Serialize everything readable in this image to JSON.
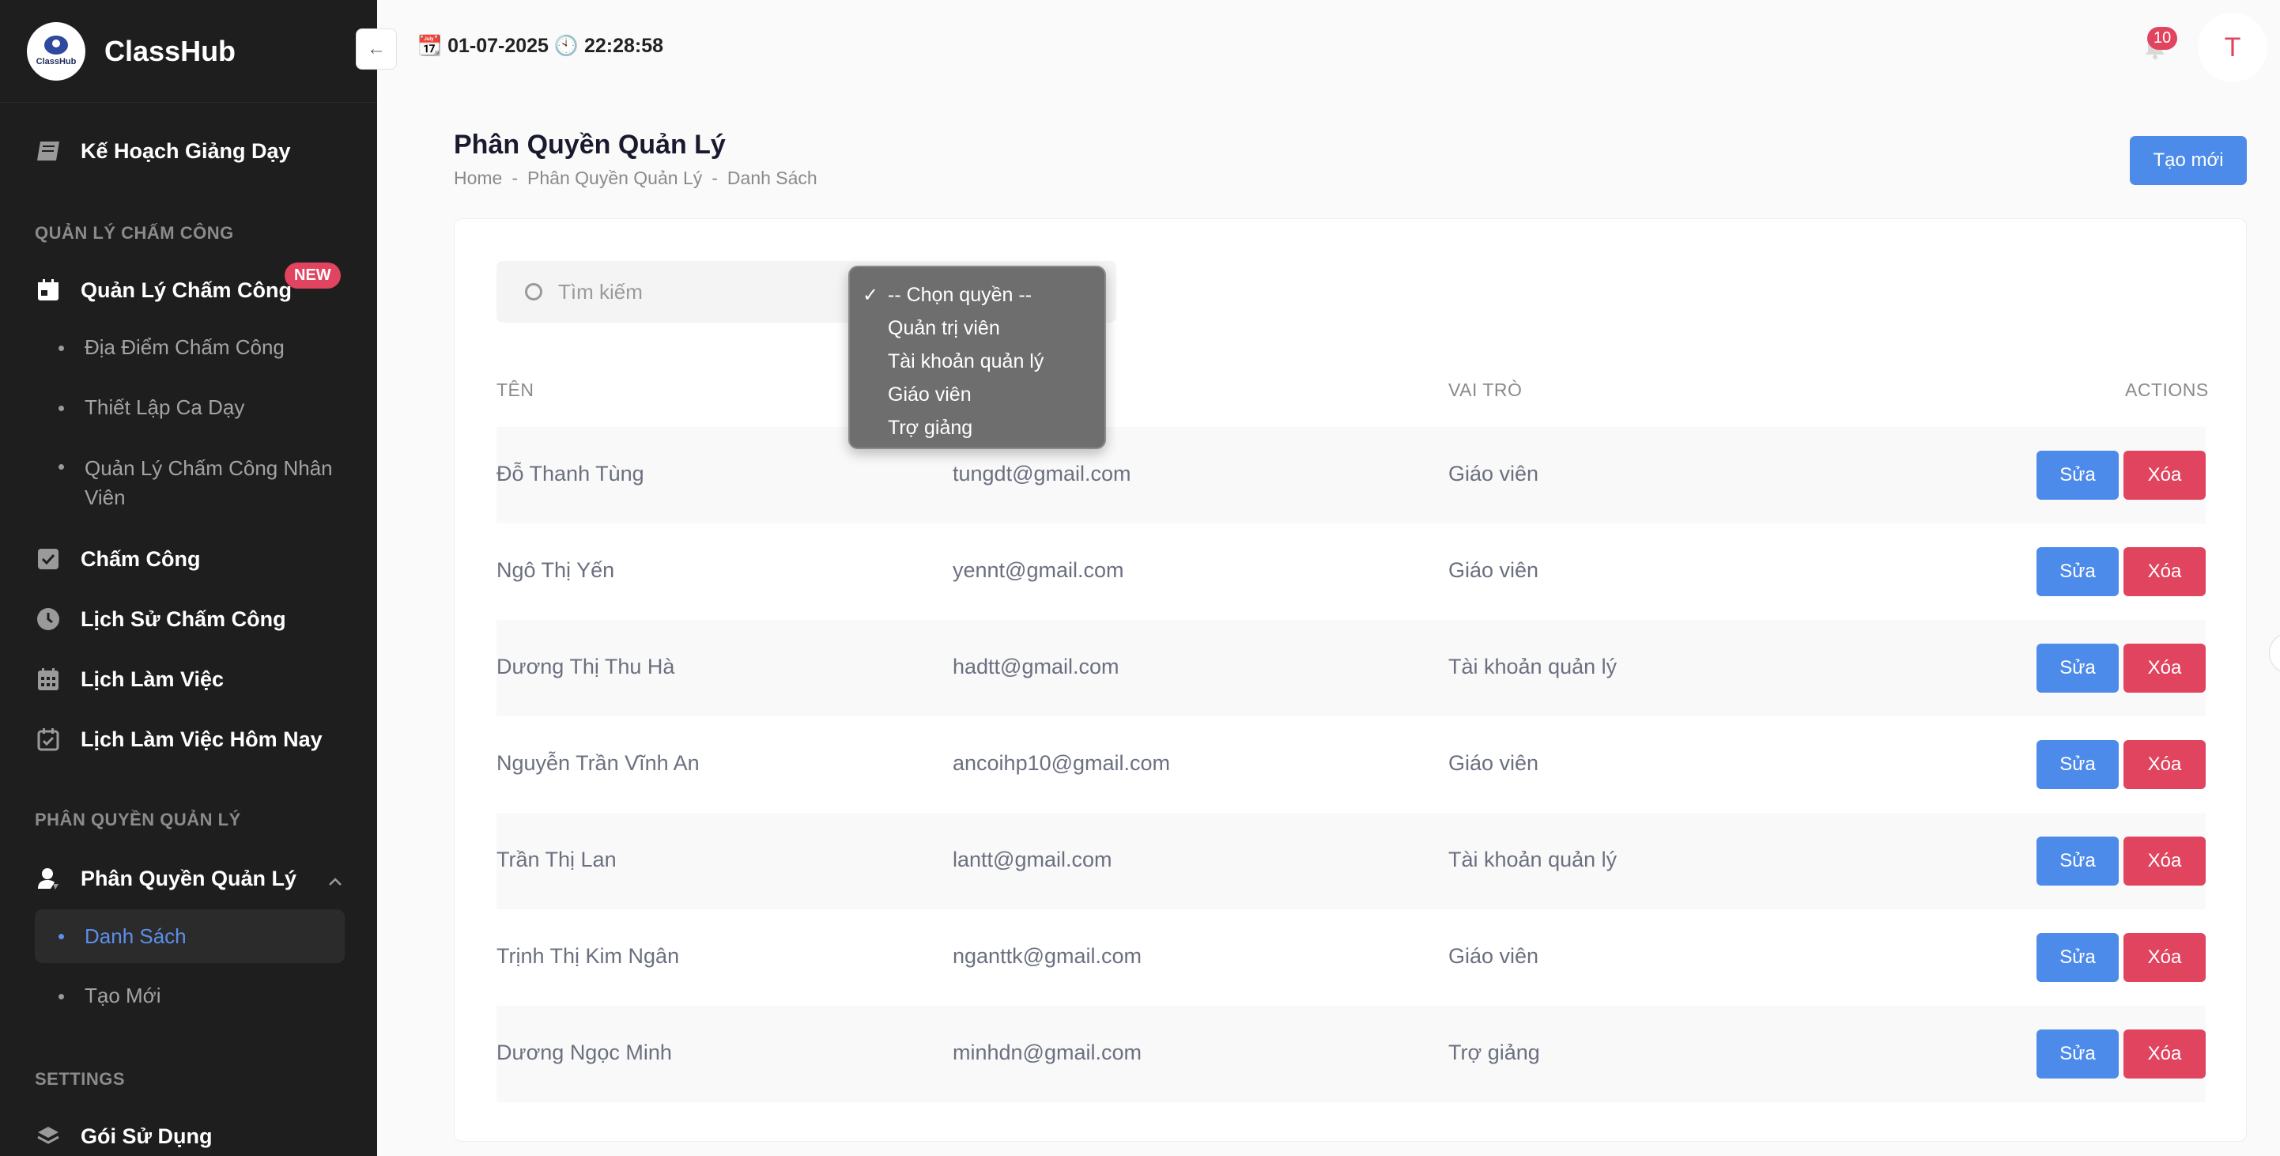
{
  "brand": {
    "name": "ClassHub",
    "logo_text": "ClassHub"
  },
  "header": {
    "datetime": "📆 01-07-2025 🕙 22:28:58",
    "notification_count": "10",
    "avatar_initial": "T",
    "collapse_icon": "←"
  },
  "sidebar": {
    "top_item": "Kế Hoạch Giảng Dạy",
    "section_attendance": "QUẢN LÝ CHẤM CÔNG",
    "attendance_manage": "Quản Lý Chấm Công",
    "new_badge": "NEW",
    "sub_locations": "Địa Điểm Chấm Công",
    "sub_shifts": "Thiết Lập Ca Dạy",
    "sub_staff_line1": "Quản Lý Chấm Công Nhân",
    "sub_staff_line2": "Viên",
    "checkin": "Chấm Công",
    "history": "Lịch Sử Chấm Công",
    "schedule": "Lịch Làm Việc",
    "schedule_today": "Lịch Làm Việc Hôm Nay",
    "section_perm": "PHÂN QUYỀN QUẢN LÝ",
    "perm_manage": "Phân Quyền Quản Lý",
    "perm_list": "Danh Sách",
    "perm_create": "Tạo Mới",
    "section_settings": "SETTINGS",
    "plans": "Gói Sử Dụng"
  },
  "page": {
    "title": "Phân Quyền Quản Lý",
    "breadcrumb": [
      "Home",
      "-",
      "Phân Quyền Quản Lý",
      "-",
      "Danh Sách"
    ],
    "create_button": "Tạo mới"
  },
  "search": {
    "placeholder": "Tìm kiếm"
  },
  "role_dropdown": {
    "check": "✓",
    "options": [
      "-- Chọn quyền --",
      "Quản trị viên",
      "Tài khoản quản lý",
      "Giáo viên",
      "Trợ giảng"
    ]
  },
  "table": {
    "headers": {
      "name": "TÊN",
      "role": "VAI TRÒ",
      "actions": "ACTIONS"
    },
    "edit_label": "Sửa",
    "delete_label": "Xóa",
    "rows": [
      {
        "name": "Đỗ Thanh Tùng",
        "email": "tungdt@gmail.com",
        "role": "Giáo viên"
      },
      {
        "name": "Ngô Thị Yến",
        "email": "yennt@gmail.com",
        "role": "Giáo viên"
      },
      {
        "name": "Dương Thị Thu Hà",
        "email": "hadtt@gmail.com",
        "role": "Tài khoản quản lý"
      },
      {
        "name": "Nguyễn Trần Vĩnh An",
        "email": "ancoihp10@gmail.com",
        "role": "Giáo viên"
      },
      {
        "name": "Trần Thị Lan",
        "email": "lantt@gmail.com",
        "role": "Tài khoản quản lý"
      },
      {
        "name": "Trịnh Thị Kim Ngân",
        "email": "nganttk@gmail.com",
        "role": "Giáo viên"
      },
      {
        "name": "Dương Ngọc Minh",
        "email": "minhdn@gmail.com",
        "role": "Trợ giảng"
      }
    ]
  },
  "colors": {
    "primary": "#4d8bea",
    "danger": "#e0445e",
    "sidebar_bg": "#1e1e1e"
  },
  "icons": [
    "book-icon",
    "calendar-icon",
    "checkbox-icon",
    "clock-icon",
    "calendar-grid-icon",
    "calendar-check-icon",
    "user-shield-icon",
    "chevron-up-icon",
    "layers-icon",
    "bell-icon",
    "search-icon"
  ]
}
